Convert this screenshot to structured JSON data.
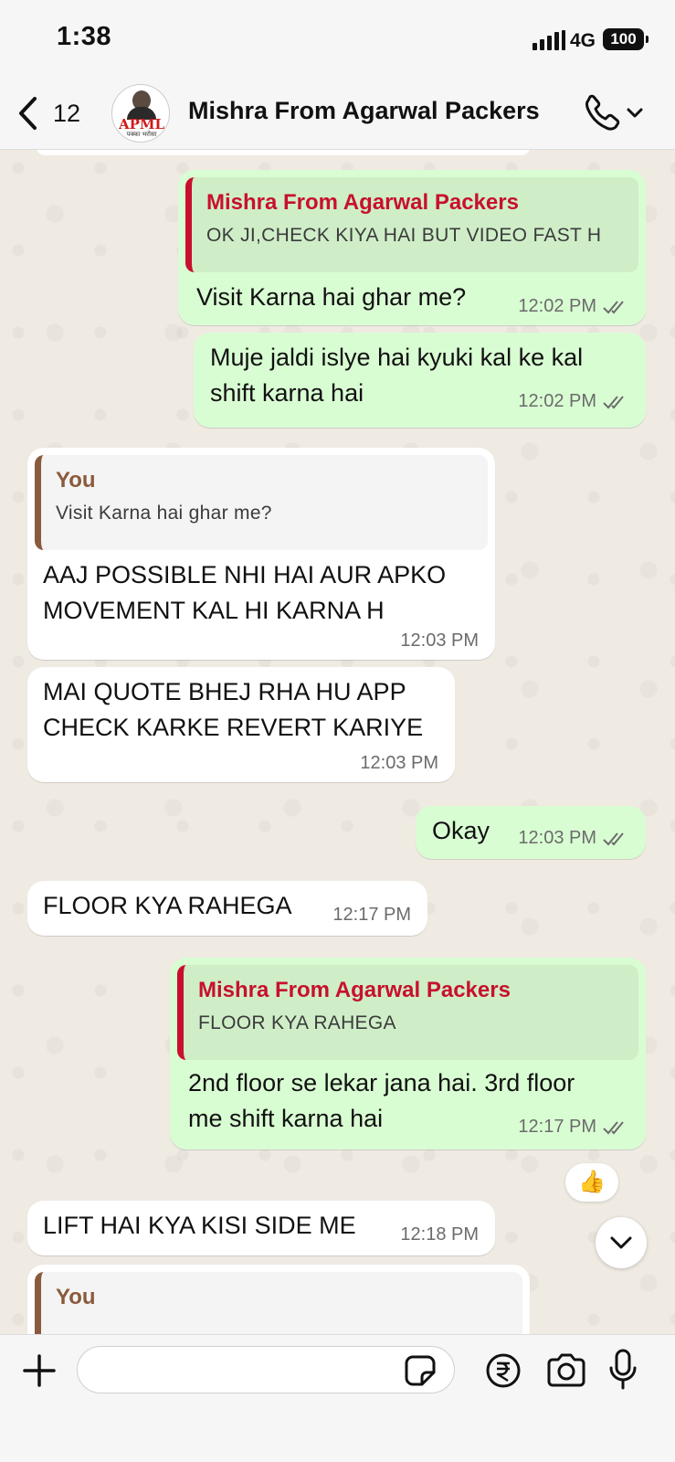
{
  "status_bar": {
    "time": "1:38",
    "network": "4G",
    "battery": "100"
  },
  "header": {
    "back_count": "12",
    "title": "Mishra From Agarwal Packers",
    "avatar_brand": "APML",
    "avatar_tagline": "पक्का भरोसा"
  },
  "messages": [
    {
      "direction": "out",
      "quote_name": "Mishra From Agarwal Packers",
      "quote_text": "OK JI,CHECK KIYA HAI BUT VIDEO FAST H",
      "text": "Visit Karna hai ghar me?",
      "time": "12:02 PM"
    },
    {
      "direction": "out",
      "text_line1": "Muje jaldi islye hai kyuki kal ke kal",
      "text_line2": "shift karna hai",
      "time": "12:02 PM"
    },
    {
      "direction": "in",
      "quote_name": "You",
      "quote_text": "Visit Karna hai ghar me?",
      "text_line1": "AAJ POSSIBLE NHI HAI AUR APKO",
      "text_line2": "MOVEMENT KAL HI KARNA H",
      "time": "12:03 PM"
    },
    {
      "direction": "in",
      "text_line1": "MAI QUOTE BHEJ RHA HU APP",
      "text_line2": "CHECK KARKE REVERT KARIYE",
      "time": "12:03 PM"
    },
    {
      "direction": "out",
      "text": "Okay",
      "time": "12:03 PM"
    },
    {
      "direction": "in",
      "text": "FLOOR KYA RAHEGA",
      "time": "12:17 PM"
    },
    {
      "direction": "out",
      "quote_name": "Mishra From Agarwal Packers",
      "quote_text": "FLOOR KYA RAHEGA",
      "text_line1": "2nd floor se lekar jana hai. 3rd floor",
      "text_line2": "me shift karna hai",
      "time": "12:17 PM",
      "reaction": "👍"
    },
    {
      "direction": "in",
      "text": "LIFT HAI KYA KISI SIDE ME",
      "time": "12:18 PM"
    },
    {
      "direction": "in",
      "quote_name": "You"
    }
  ],
  "input": {
    "value": "",
    "placeholder": ""
  },
  "colors": {
    "outgoing_bubble": "#d9fdd3",
    "incoming_bubble": "#ffffff",
    "quote_red": "#c8102e",
    "quote_brown": "#8a5a3c",
    "chat_bg": "#efeae2"
  },
  "icons": [
    "back-chevron-icon",
    "call-icon",
    "chevron-down-icon",
    "plus-icon",
    "sticker-icon",
    "rupee-payment-icon",
    "camera-icon",
    "microphone-icon",
    "double-check-icon"
  ]
}
